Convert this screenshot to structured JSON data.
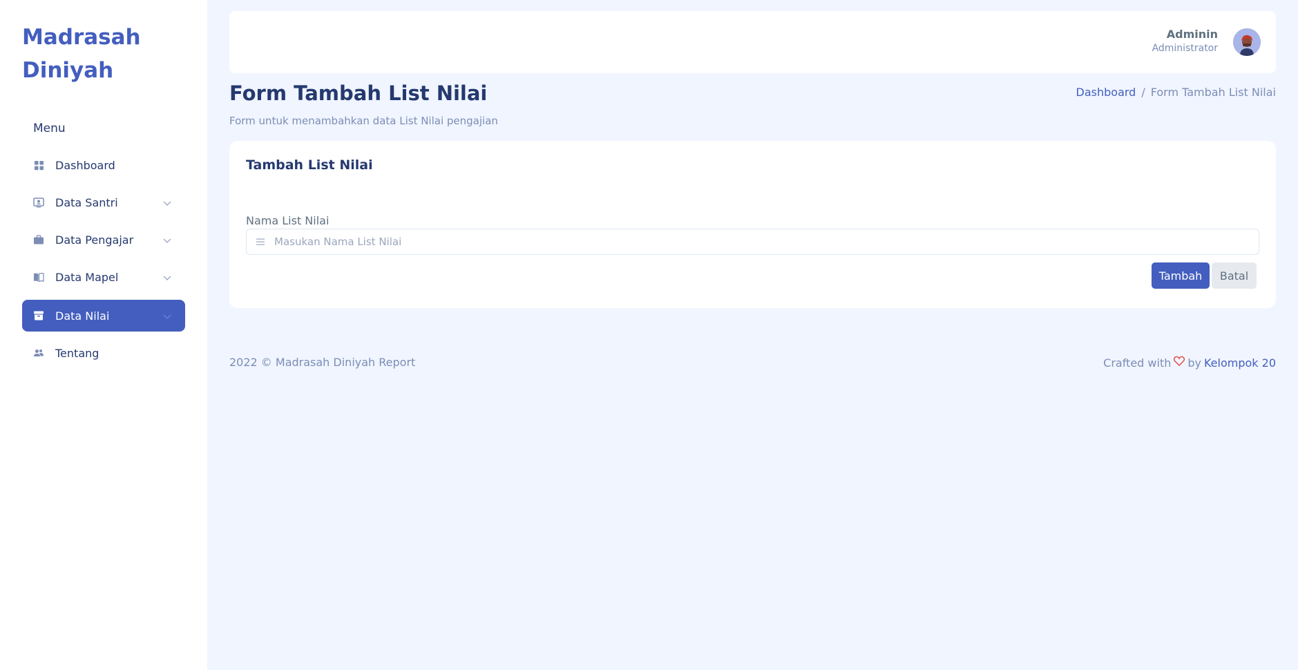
{
  "sidebar": {
    "brand": "Madrasah Diniyah",
    "menu_title": "Menu",
    "items": [
      {
        "label": "Dashboard",
        "icon": "grid-icon",
        "has_submenu": false,
        "active": false
      },
      {
        "label": "Data Santri",
        "icon": "person-badge-icon",
        "has_submenu": true,
        "active": false
      },
      {
        "label": "Data Pengajar",
        "icon": "briefcase-icon",
        "has_submenu": true,
        "active": false
      },
      {
        "label": "Data Mapel",
        "icon": "book-icon",
        "has_submenu": true,
        "active": false
      },
      {
        "label": "Data Nilai",
        "icon": "archive-icon",
        "has_submenu": true,
        "active": true
      },
      {
        "label": "Tentang",
        "icon": "people-icon",
        "has_submenu": false,
        "active": false
      }
    ]
  },
  "header": {
    "user_name": "Adminin",
    "user_role": "Administrator"
  },
  "page": {
    "title": "Form Tambah List Nilai",
    "subtitle": "Form untuk menambahkan data List Nilai pengajian",
    "breadcrumb": {
      "link": "Dashboard",
      "separator": "/",
      "current": "Form Tambah List Nilai"
    }
  },
  "form": {
    "card_title": "Tambah List Nilai",
    "field_label": "Nama List Nilai",
    "field_value": "",
    "field_placeholder": "Masukan Nama List Nilai",
    "submit_label": "Tambah",
    "cancel_label": "Batal"
  },
  "footer": {
    "left": "2022 © Madrasah Diniyah Report",
    "crafted": "Crafted with",
    "by": "by",
    "team": "Kelompok 20"
  },
  "colors": {
    "primary": "#435ebe",
    "background": "#f0f5ff",
    "text": "#25396f",
    "muted": "#7c8db5",
    "heart": "#e53f3c"
  }
}
